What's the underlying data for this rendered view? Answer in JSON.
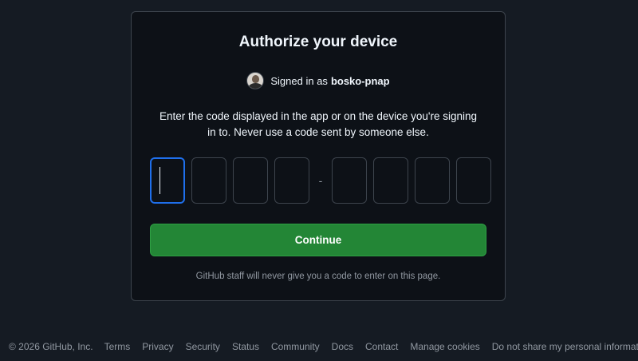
{
  "card": {
    "title": "Authorize your device",
    "signed_in_prefix": "Signed in as",
    "username": "bosko-pnap",
    "instructions": "Enter the code displayed in the app or on the device you're signing in to. Never use a code sent by someone else.",
    "code": {
      "separator": "-",
      "values": [
        "",
        "",
        "",
        "",
        "",
        "",
        "",
        ""
      ]
    },
    "continue_label": "Continue",
    "note": "GitHub staff will never give you a code to enter on this page."
  },
  "footer": {
    "copyright": "© 2026 GitHub, Inc.",
    "links": [
      "Terms",
      "Privacy",
      "Security",
      "Status",
      "Community",
      "Docs",
      "Contact",
      "Manage cookies",
      "Do not share my personal information"
    ]
  },
  "colors": {
    "page_bg": "#151b23",
    "card_bg": "#0d1117",
    "accent_focus": "#1f6feb",
    "button_green": "#238636"
  },
  "icons": {
    "footer_logo": "github-mark-icon",
    "user_avatar": "avatar"
  }
}
